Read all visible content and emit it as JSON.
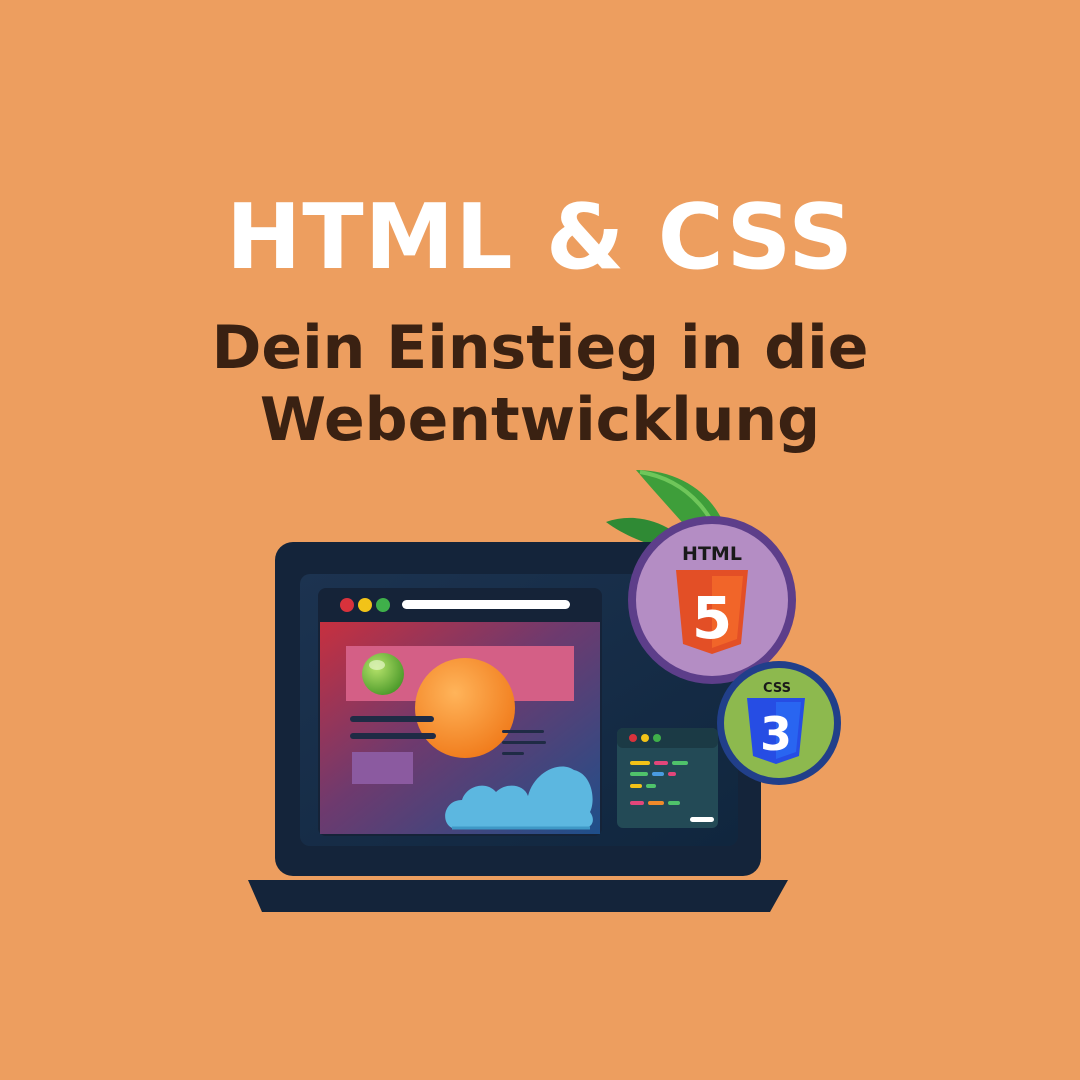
{
  "headline": {
    "title": "HTML & CSS",
    "subtitle_line1": "Dein Einstieg in die",
    "subtitle_line2": "Webentwicklung"
  },
  "badges": {
    "html": {
      "label": "HTML",
      "number": "5"
    },
    "css": {
      "label": "CSS",
      "number": "3"
    }
  },
  "colors": {
    "background": "#ED9E5F",
    "title": "#FFFFFF",
    "subtitle": "#3A2112",
    "laptop_frame": "#14243A",
    "html_badge": "#B48DC4",
    "html_shield": "#E34F26",
    "css_badge": "#8DB94E",
    "css_shield": "#2965F1",
    "leaf": "#3E9E3A"
  }
}
